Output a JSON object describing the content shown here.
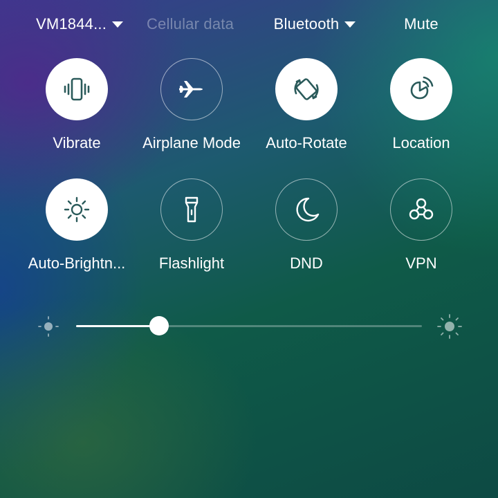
{
  "top_bar": {
    "wifi": {
      "label": "VM1844...",
      "has_dropdown": true
    },
    "cellular": {
      "label": "Cellular data",
      "enabled": false
    },
    "bluetooth": {
      "label": "Bluetooth",
      "has_dropdown": true
    },
    "sound": {
      "label": "Mute"
    }
  },
  "tiles_row1": [
    {
      "label": "Vibrate",
      "icon": "vibrate-icon",
      "active": true
    },
    {
      "label": "Airplane Mode",
      "icon": "airplane-icon",
      "active": false
    },
    {
      "label": "Auto-Rotate",
      "icon": "auto-rotate-icon",
      "active": true
    },
    {
      "label": "Location",
      "icon": "location-icon",
      "active": true
    }
  ],
  "tiles_row2": [
    {
      "label": "Auto-Brightn...",
      "icon": "auto-brightness-icon",
      "active": true
    },
    {
      "label": "Flashlight",
      "icon": "flashlight-icon",
      "active": false
    },
    {
      "label": "DND",
      "icon": "moon-icon",
      "active": false
    },
    {
      "label": "VPN",
      "icon": "vpn-icon",
      "active": false
    }
  ],
  "brightness": {
    "level": 0.24,
    "min_icon": "brightness-low-icon",
    "max_icon": "brightness-high-icon"
  },
  "colors": {
    "active_tile_bg": "#ffffff",
    "active_icon": "#2a5a5a",
    "inactive_icon": "#ffffff"
  }
}
